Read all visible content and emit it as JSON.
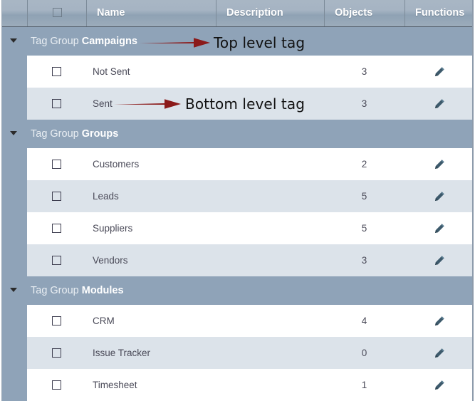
{
  "table": {
    "columns": [
      {
        "key": "handle",
        "label": ""
      },
      {
        "key": "checkbox",
        "label": ""
      },
      {
        "key": "name",
        "label": "Name"
      },
      {
        "key": "description",
        "label": "Description"
      },
      {
        "key": "objects",
        "label": "Objects"
      },
      {
        "key": "functions",
        "label": "Functions"
      }
    ],
    "select_all_checkbox": {
      "checked": false
    },
    "groups": [
      {
        "prefix": "Tag Group ",
        "name": "Campaigns",
        "expanded": true,
        "toggle_icon": "chevron-down-icon",
        "rows": [
          {
            "name": "Not Sent",
            "description": "",
            "objects": "3",
            "checked": false,
            "action_icon": "pencil-icon"
          },
          {
            "name": "Sent",
            "description": "",
            "objects": "3",
            "checked": false,
            "action_icon": "pencil-icon"
          }
        ]
      },
      {
        "prefix": "Tag Group ",
        "name": "Groups",
        "expanded": true,
        "toggle_icon": "chevron-down-icon",
        "rows": [
          {
            "name": "Customers",
            "description": "",
            "objects": "2",
            "checked": false,
            "action_icon": "pencil-icon"
          },
          {
            "name": "Leads",
            "description": "",
            "objects": "5",
            "checked": false,
            "action_icon": "pencil-icon"
          },
          {
            "name": "Suppliers",
            "description": "",
            "objects": "5",
            "checked": false,
            "action_icon": "pencil-icon"
          },
          {
            "name": "Vendors",
            "description": "",
            "objects": "3",
            "checked": false,
            "action_icon": "pencil-icon"
          }
        ]
      },
      {
        "prefix": "Tag Group ",
        "name": "Modules",
        "expanded": true,
        "toggle_icon": "chevron-down-icon",
        "rows": [
          {
            "name": "CRM",
            "description": "",
            "objects": "4",
            "checked": false,
            "action_icon": "pencil-icon"
          },
          {
            "name": "Issue Tracker",
            "description": "",
            "objects": "0",
            "checked": false,
            "action_icon": "pencil-icon"
          },
          {
            "name": "Timesheet",
            "description": "",
            "objects": "1",
            "checked": false,
            "action_icon": "pencil-icon"
          }
        ]
      }
    ]
  },
  "annotations": [
    {
      "id": "top-level",
      "text": "Top level tag",
      "arrow_color": "#8b1a1a"
    },
    {
      "id": "bottom-level",
      "text": "Bottom level tag",
      "arrow_color": "#8b1a1a"
    }
  ],
  "colors": {
    "header_top": "#a8b6c4",
    "header_bottom": "#9cacbb",
    "group_row": "#8fa3b8",
    "row_white": "#ffffff",
    "row_alt": "#dce3ea",
    "text_dark": "#4a4a58",
    "pencil": "#3d5a6c",
    "annotation_red": "#8b1a1a"
  }
}
